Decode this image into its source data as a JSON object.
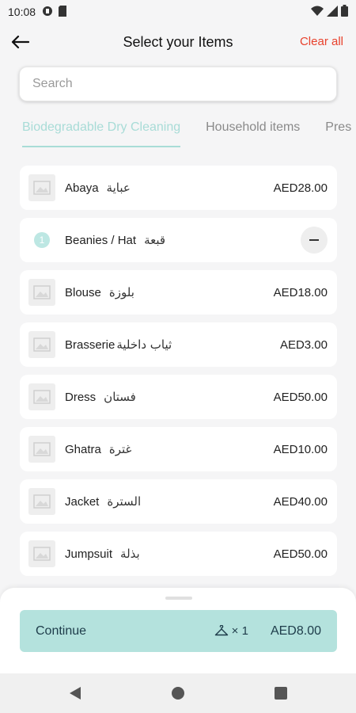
{
  "status_bar": {
    "time": "10:08"
  },
  "header": {
    "title": "Select your Items",
    "clear_label": "Clear all"
  },
  "search": {
    "placeholder": "Search"
  },
  "tabs": [
    {
      "label": "Biodegradable Dry Cleaning",
      "active": true
    },
    {
      "label": "Household items",
      "active": false
    },
    {
      "label": "Pres",
      "active": false
    }
  ],
  "items": [
    {
      "name": "Abaya",
      "arabic": "عباية",
      "price": "AED28.00"
    },
    {
      "name": "Beanies / Hat",
      "arabic": "قبعة",
      "quantity": "1"
    },
    {
      "name": "Blouse",
      "arabic": "بلوزة",
      "price": "AED18.00"
    },
    {
      "name": "Brasserie",
      "arabic": "ثياب داخلية",
      "price": "AED3.00"
    },
    {
      "name": "Dress",
      "arabic": "فستان",
      "price": "AED50.00"
    },
    {
      "name": "Ghatra",
      "arabic": "غترة",
      "price": "AED10.00"
    },
    {
      "name": "Jacket",
      "arabic": "السترة",
      "price": "AED40.00"
    },
    {
      "name": "Jumpsuit",
      "arabic": "بذلة",
      "price": "AED50.00"
    }
  ],
  "footer": {
    "continue_label": "Continue",
    "count": "× 1",
    "total": "AED8.00"
  },
  "colors": {
    "accent": "#a8dcd7",
    "button": "#b4e2dd",
    "danger": "#e8412c"
  },
  "icons": [
    "back-arrow-icon",
    "hanger-icon",
    "image-placeholder-icon",
    "minus-icon"
  ]
}
